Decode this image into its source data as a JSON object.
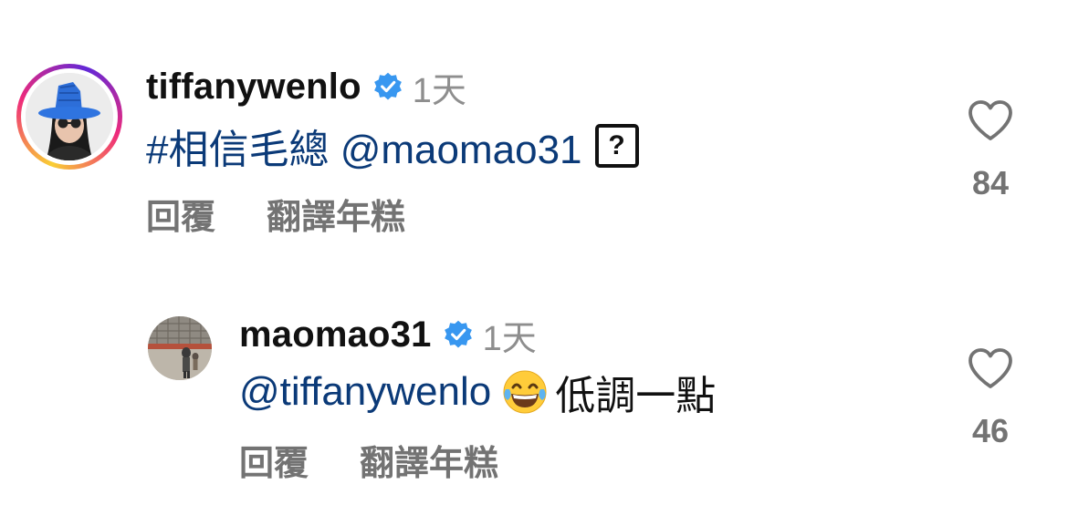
{
  "comments": [
    {
      "username": "tiffanywenlo",
      "verified": true,
      "time": "1天",
      "hashtag": "#相信毛總",
      "mention": "@maomao31",
      "trailing_icon": "question-box-icon",
      "text": "",
      "actions": {
        "reply": "回覆",
        "translate": "翻譯年糕"
      },
      "likes": "84"
    },
    {
      "username": "maomao31",
      "verified": true,
      "time": "1天",
      "mention": "@tiffanywenlo",
      "emoji": "tears-of-joy-emoji",
      "text": "低調一點",
      "actions": {
        "reply": "回覆",
        "translate": "翻譯年糕"
      },
      "likes": "46"
    }
  ],
  "colors": {
    "verified_badge": "#3897f0",
    "mention": "#00376b",
    "secondary_text": "#737373"
  }
}
